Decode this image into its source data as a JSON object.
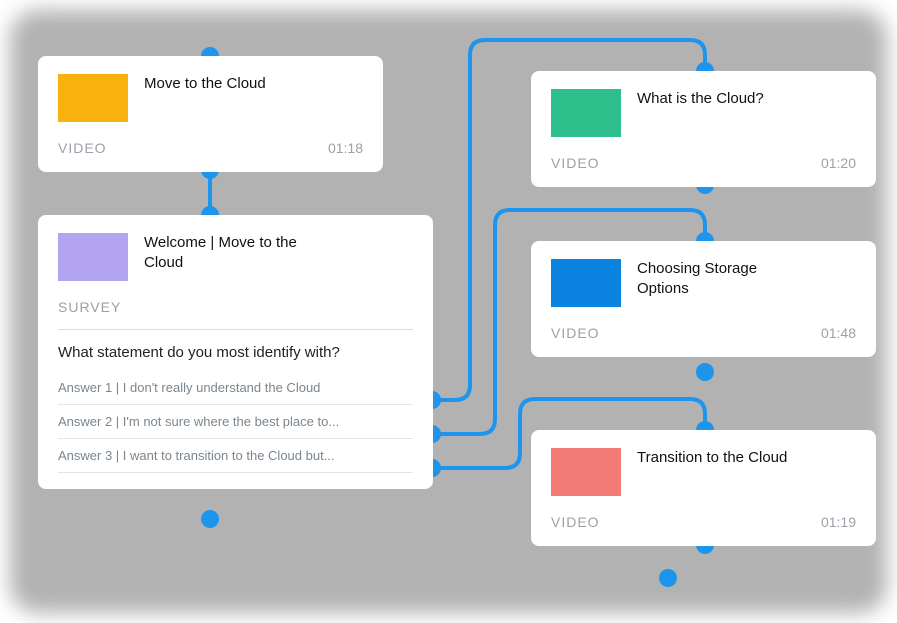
{
  "colors": {
    "connector": "#1e95ed",
    "node_bg": "#ffffff",
    "thumb_move": "#f7b20f",
    "thumb_welcome": "#b3a4f2",
    "thumb_what": "#2dc08d",
    "thumb_storage": "#0a84e0",
    "thumb_transition": "#f27a75"
  },
  "nodes": {
    "move": {
      "title": "Move to the Cloud",
      "kind": "VIDEO",
      "time": "01:18"
    },
    "welcome": {
      "title": "Welcome | Move to the Cloud",
      "kind": "SURVEY",
      "question": "What statement do you most identify with?",
      "answers": [
        "Answer 1 | I don't really understand the Cloud",
        "Answer 2 | I'm not sure where the best place to...",
        "Answer 3 | I want to transition to the Cloud but..."
      ]
    },
    "what": {
      "title": "What is the Cloud?",
      "kind": "VIDEO",
      "time": "01:20"
    },
    "storage": {
      "title": "Choosing Storage Options",
      "kind": "VIDEO",
      "time": "01:48"
    },
    "transition": {
      "title": "Transition to the Cloud",
      "kind": "VIDEO",
      "time": "01:19"
    }
  }
}
